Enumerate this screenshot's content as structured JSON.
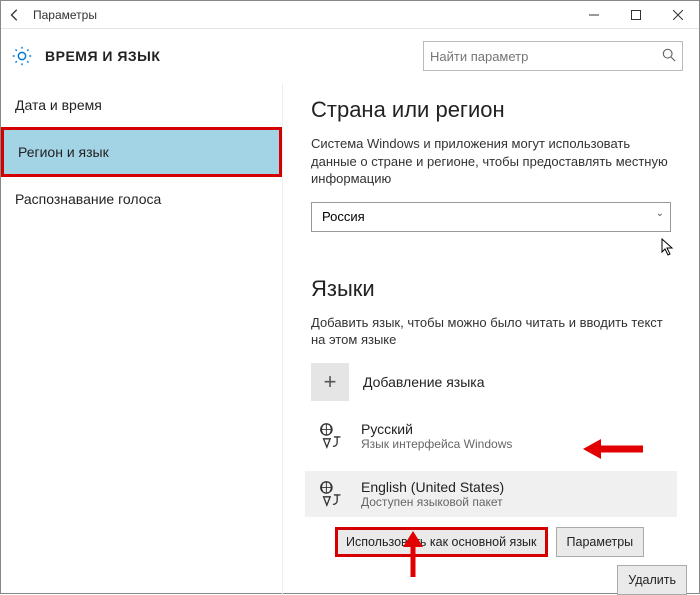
{
  "titlebar": {
    "title": "Параметры"
  },
  "header": {
    "title": "ВРЕМЯ И ЯЗЫК"
  },
  "search": {
    "placeholder": "Найти параметр"
  },
  "sidebar": {
    "items": [
      {
        "label": "Дата и время"
      },
      {
        "label": "Регион и язык"
      },
      {
        "label": "Распознавание голоса"
      }
    ]
  },
  "region": {
    "heading": "Страна или регион",
    "desc": "Система Windows и приложения могут использовать данные о стране и регионе, чтобы предоставлять местную информацию",
    "value": "Россия"
  },
  "languages": {
    "heading": "Языки",
    "desc": "Добавить язык, чтобы можно было читать и вводить текст на этом языке",
    "add_label": "Добавление языка",
    "items": [
      {
        "name": "Русский",
        "sub": "Язык интерфейса Windows"
      },
      {
        "name": "English (United States)",
        "sub": "Доступен языковой пакет"
      }
    ]
  },
  "buttons": {
    "set_default": "Использовать как основной язык",
    "options": "Параметры",
    "remove": "Удалить"
  }
}
